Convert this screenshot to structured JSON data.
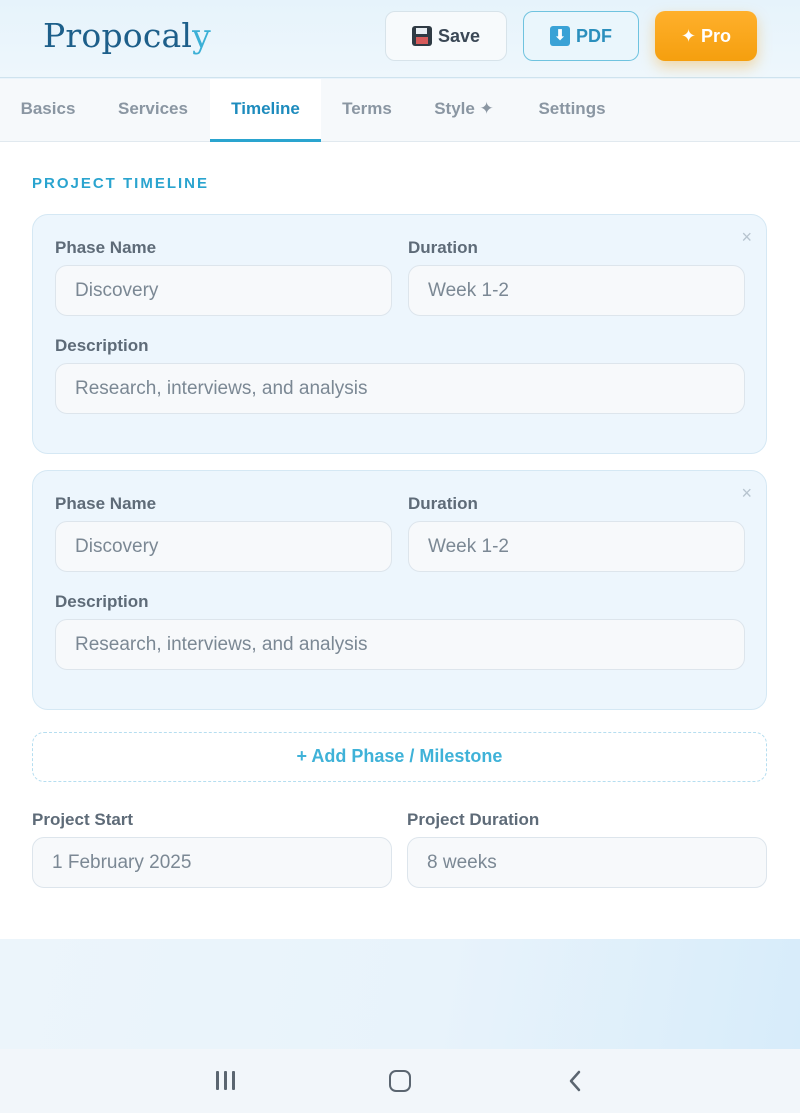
{
  "header": {
    "logo_main": "Propocal",
    "logo_accent": "y",
    "save_label": "Save",
    "pdf_label": "PDF",
    "pro_label": "✦ Pro"
  },
  "tabs": [
    {
      "label": "Basics"
    },
    {
      "label": "Services"
    },
    {
      "label": "Timeline",
      "active": true
    },
    {
      "label": "Terms"
    },
    {
      "label": "Style ✦"
    },
    {
      "label": "Settings"
    }
  ],
  "section_title": "PROJECT TIMELINE",
  "phases": [
    {
      "phase_label": "Phase Name",
      "phase_value": "Discovery",
      "duration_label": "Duration",
      "duration_value": "Week 1-2",
      "description_label": "Description",
      "description_value": "Research, interviews, and analysis",
      "close": "×"
    },
    {
      "phase_label": "Phase Name",
      "phase_value": "Discovery",
      "duration_label": "Duration",
      "duration_value": "Week 1-2",
      "description_label": "Description",
      "description_value": "Research, interviews, and analysis",
      "close": "×"
    }
  ],
  "add_phase_label": "+ Add Phase / Milestone",
  "project": {
    "start_label": "Project Start",
    "start_value": "1 February 2025",
    "duration_label": "Project Duration",
    "duration_value": "8 weeks"
  },
  "colors": {
    "accent": "#2aa4cf",
    "brand": "#1d5f8a",
    "pro": "#f59f0e"
  },
  "icons": {
    "save": "floppy-disk-icon",
    "pdf": "download-arrow-icon",
    "close": "close-icon",
    "nav_recent": "recent-apps-icon",
    "nav_home": "home-icon",
    "nav_back": "back-icon"
  }
}
